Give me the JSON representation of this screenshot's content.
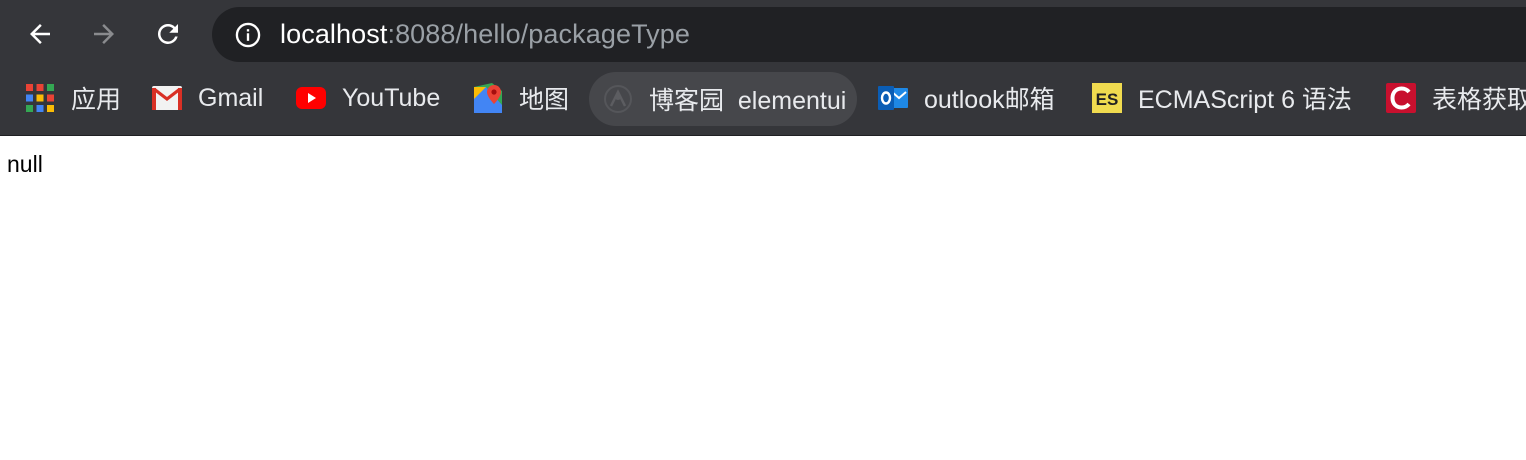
{
  "toolbar": {
    "back_icon": "arrow-left-icon",
    "forward_icon": "arrow-right-icon",
    "reload_icon": "reload-icon",
    "info_icon": "info-icon",
    "url_host": "localhost",
    "url_rest": ":8088/hello/packageType"
  },
  "bookmarks": [
    {
      "label": "应用",
      "icon": "apps-grid-icon"
    },
    {
      "label": "Gmail",
      "icon": "gmail-icon"
    },
    {
      "label": "YouTube",
      "icon": "youtube-icon"
    },
    {
      "label": "地图",
      "icon": "maps-icon"
    },
    {
      "label": "博客园  elementui",
      "icon": "cnblogs-icon"
    },
    {
      "label": "outlook邮箱",
      "icon": "outlook-icon"
    },
    {
      "label": "ECMAScript 6 语法",
      "icon": "es-icon",
      "icon_text": "ES"
    },
    {
      "label": "表格获取",
      "icon": "tables-icon"
    }
  ],
  "page": {
    "body_text": "null"
  },
  "colors": {
    "toolbar_bg": "#35363a",
    "omnibox_bg": "#202124",
    "url_dim": "#9aa0a6",
    "youtube_red": "#ff0000",
    "es_yellow": "#f0db4f",
    "outlook_blue": "#0a5db5"
  }
}
